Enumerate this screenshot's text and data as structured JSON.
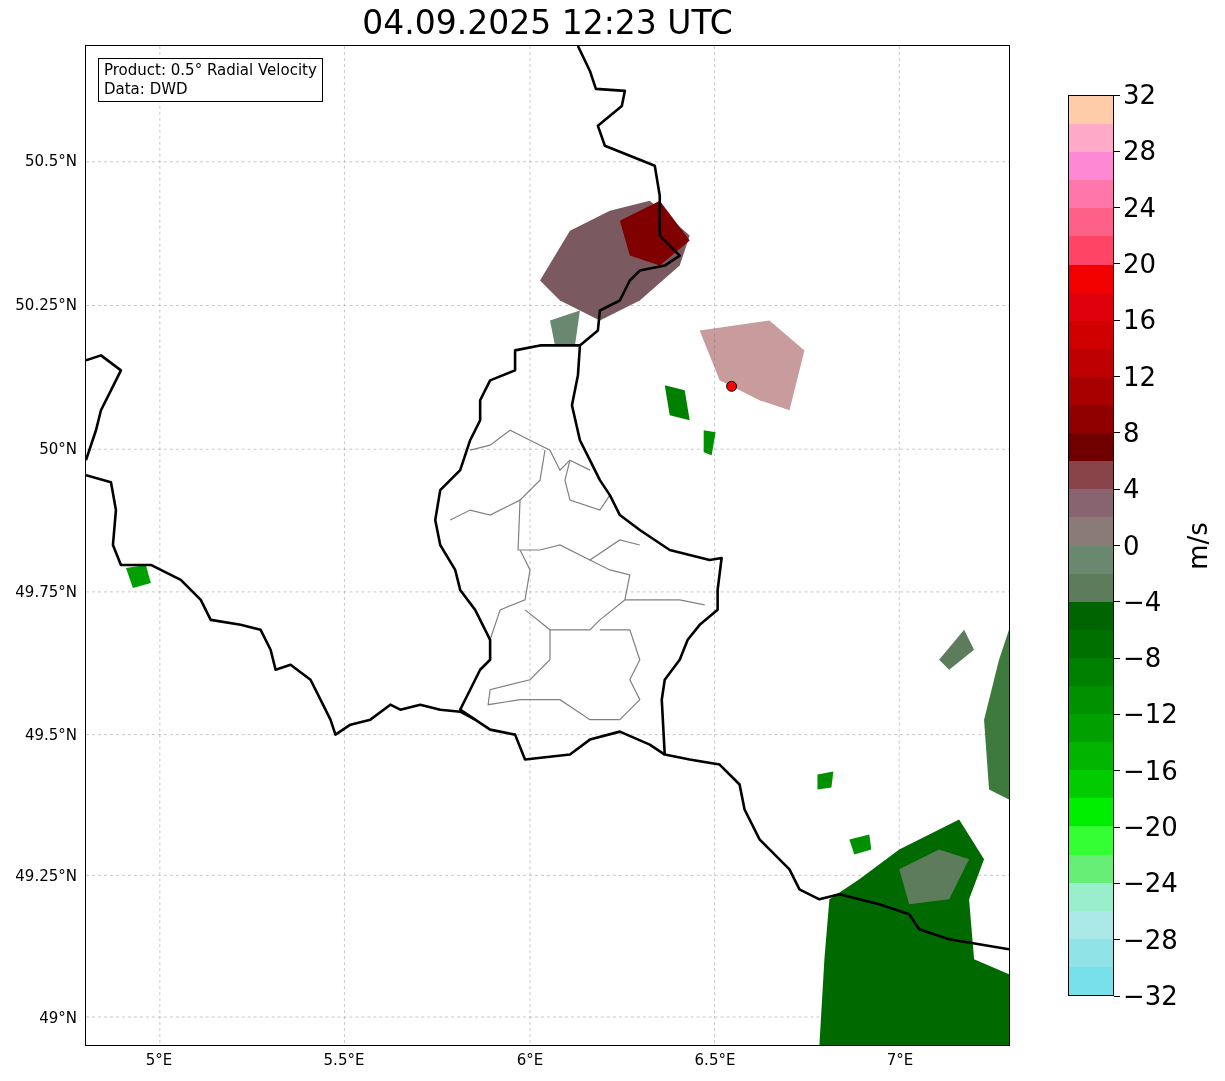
{
  "title": "04.09.2025 12:23 UTC",
  "info_box": {
    "lines": [
      "Product: 0.5° Radial Velocity",
      "Data: DWD"
    ]
  },
  "map": {
    "x_ticks": [
      "5°E",
      "5.5°E",
      "6°E",
      "6.5°E",
      "7°E"
    ],
    "y_ticks": [
      "50.5°N",
      "50.25°N",
      "50°N",
      "49.75°N",
      "49.5°N",
      "49.25°N",
      "49°N"
    ]
  },
  "colorbar": {
    "label": "m/s",
    "ticks": [
      "32",
      "28",
      "24",
      "20",
      "16",
      "12",
      "8",
      "4",
      "0",
      "−4",
      "−8",
      "−12",
      "−16",
      "−20",
      "−24",
      "−28",
      "−32"
    ],
    "segments": [
      {
        "color": "#ffccaa"
      },
      {
        "color": "#ffaac8"
      },
      {
        "color": "#ff88d4"
      },
      {
        "color": "#ff77aa"
      },
      {
        "color": "#ff6088"
      },
      {
        "color": "#ff4466"
      },
      {
        "color": "#f20000"
      },
      {
        "color": "#e0000c"
      },
      {
        "color": "#d00000"
      },
      {
        "color": "#be0000"
      },
      {
        "color": "#a80000"
      },
      {
        "color": "#900000"
      },
      {
        "color": "#700000"
      },
      {
        "color": "#884448"
      },
      {
        "color": "#886470"
      },
      {
        "color": "#8a7a78"
      },
      {
        "color": "#6a8870"
      },
      {
        "color": "#5c7c5c"
      },
      {
        "color": "#006400"
      },
      {
        "color": "#007000"
      },
      {
        "color": "#008000"
      },
      {
        "color": "#009000"
      },
      {
        "color": "#00a000"
      },
      {
        "color": "#00b400"
      },
      {
        "color": "#00cc00"
      },
      {
        "color": "#00ee00"
      },
      {
        "color": "#33ff33"
      },
      {
        "color": "#66ee77"
      },
      {
        "color": "#99eecc"
      },
      {
        "color": "#aae8e8"
      },
      {
        "color": "#90e4e8"
      },
      {
        "color": "#77e0e8"
      }
    ]
  }
}
